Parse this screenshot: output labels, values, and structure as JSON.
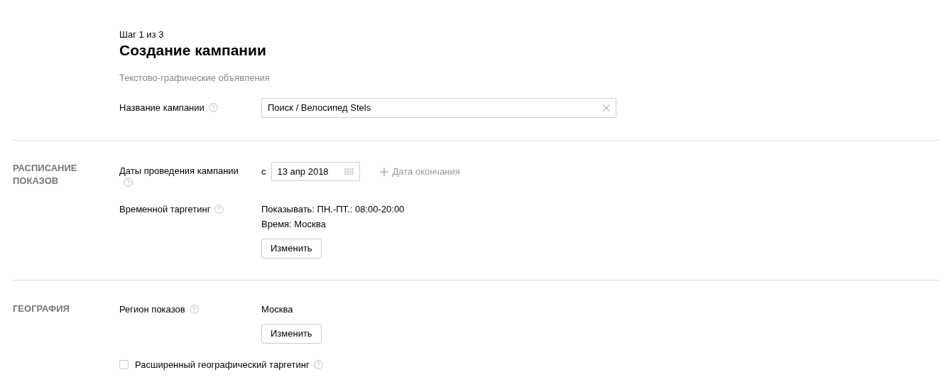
{
  "header": {
    "step": "Шаг 1 из 3",
    "title": "Создание кампании",
    "subtitle": "Текстово-графические объявления"
  },
  "campaign_name": {
    "label": "Название кампании",
    "value": "Поиск / Велосипед Stels"
  },
  "sections": [
    {
      "title": "РАСПИСАНИЕ ПОКАЗОВ",
      "rows": [
        {
          "kind": "dates",
          "label": "Даты проведения кампании",
          "prefix": "с",
          "date": "13 апр 2018",
          "add_end": "Дата окончания"
        },
        {
          "kind": "info",
          "label": "Временной таргетинг",
          "lines": [
            "Показывать: ПН.-ПТ.: 08:00-20:00",
            "Время: Москва"
          ],
          "button": "Изменить"
        }
      ]
    },
    {
      "title": "ГЕОГРАФИЯ",
      "rows": [
        {
          "kind": "info",
          "label": "Регион показов",
          "lines": [
            "Москва"
          ],
          "button": "Изменить"
        },
        {
          "kind": "checkbox",
          "label": "Расширенный географический таргетинг",
          "checked": false
        }
      ]
    }
  ]
}
